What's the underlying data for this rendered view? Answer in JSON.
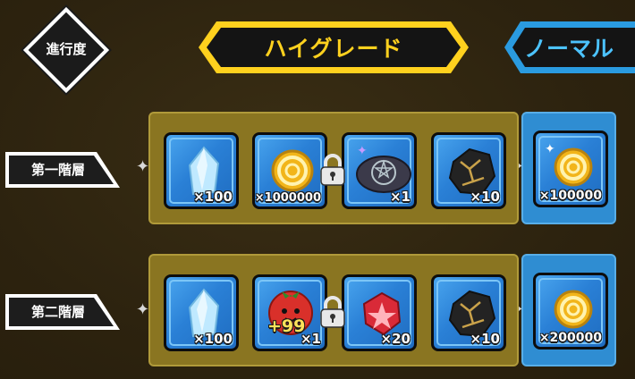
{
  "progress": {
    "label": "進行度"
  },
  "tabs": {
    "high_grade": "ハイグレード",
    "normal": "ノーマル"
  },
  "colors": {
    "high_grade_accent": "#ffd11e",
    "normal_accent": "#4cc3ff",
    "gold_panel": "#8a7521",
    "blue_panel": "#2f8dd2"
  },
  "rows": [
    {
      "label": "第一階層",
      "high_grade_rewards": [
        {
          "icon": "crystal-icon",
          "qty": "×100"
        },
        {
          "icon": "gold-coin-icon",
          "qty": "×1000000"
        },
        {
          "icon": "pentagram-stone-icon",
          "qty": "×1"
        },
        {
          "icon": "ore-rock-icon",
          "qty": "×10"
        }
      ],
      "locked": true,
      "normal_reward": {
        "icon": "gold-coin-icon",
        "qty": "×100000"
      }
    },
    {
      "label": "第二階層",
      "high_grade_rewards": [
        {
          "icon": "crystal-icon",
          "qty": "×100"
        },
        {
          "icon": "tomato-character-icon",
          "qty": "×1",
          "extra": "+99"
        },
        {
          "icon": "red-gem-icon",
          "qty": "×20"
        },
        {
          "icon": "ore-rock-icon",
          "qty": "×10"
        }
      ],
      "locked": true,
      "normal_reward": {
        "icon": "gold-coin-icon",
        "qty": "×200000"
      }
    }
  ]
}
